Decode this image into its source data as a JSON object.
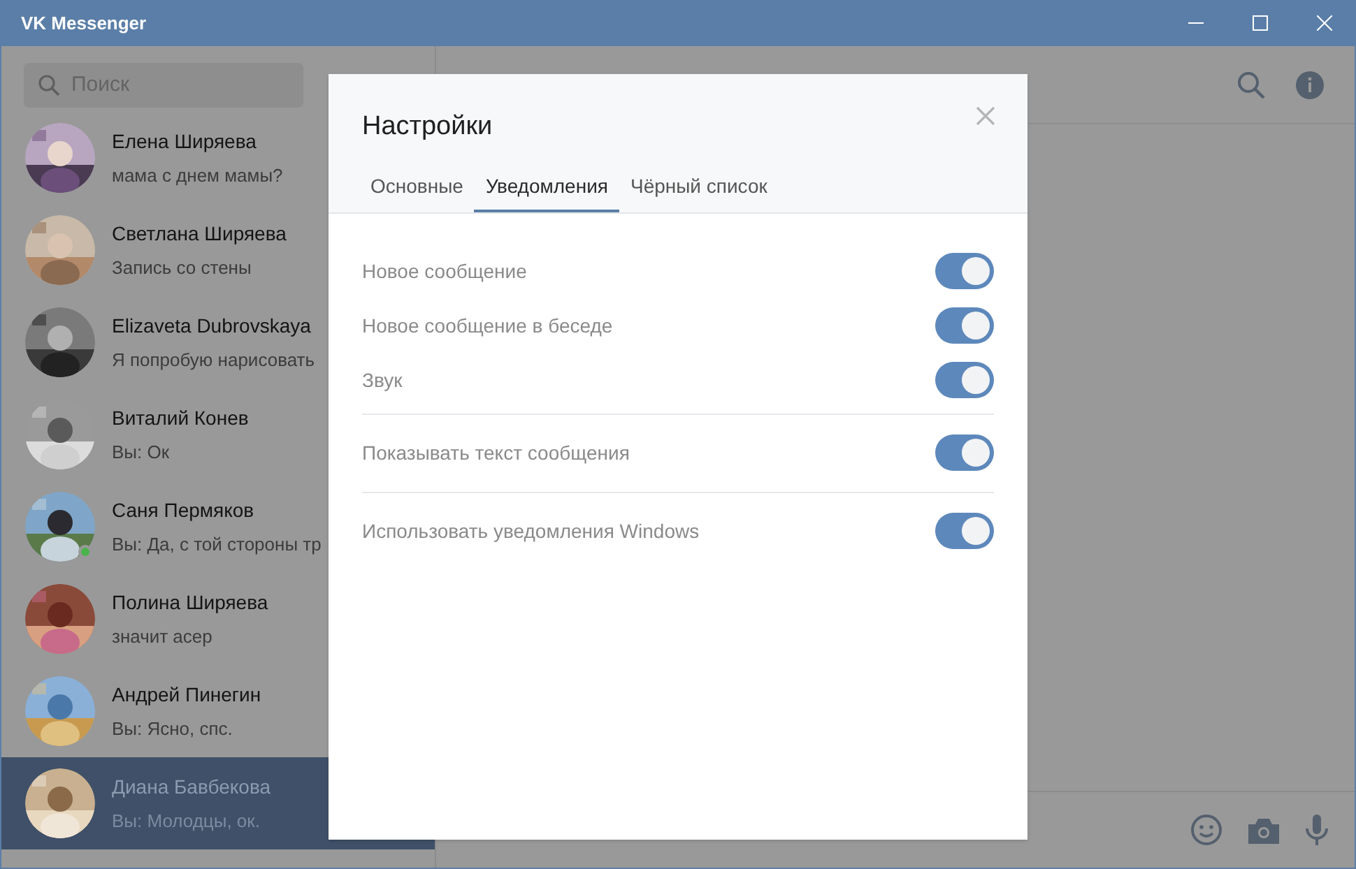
{
  "window": {
    "title": "VK Messenger"
  },
  "sidebar": {
    "search": {
      "placeholder": "Поиск"
    },
    "dialogs": [
      {
        "name": "Елена Ширяева",
        "preview": "мама с днем мамы?",
        "online": false,
        "selected": false
      },
      {
        "name": "Светлана Ширяева",
        "preview": "Запись со стены",
        "online": false,
        "selected": false
      },
      {
        "name": "Elizaveta Dubrovskaya",
        "preview": "Я попробую нарисовать",
        "online": false,
        "selected": false
      },
      {
        "name": "Виталий Конев",
        "preview": "Вы: Ок",
        "online": false,
        "selected": false
      },
      {
        "name": "Саня Пермяков",
        "preview": "Вы: Да, с той стороны тр",
        "online": true,
        "selected": false
      },
      {
        "name": "Полина Ширяева",
        "preview": "значит асер",
        "online": false,
        "selected": false
      },
      {
        "name": "Андрей Пинегин",
        "preview": "Вы: Ясно, спс.",
        "online": false,
        "selected": false
      },
      {
        "name": "Диана Бавбекова",
        "preview": "Вы: Молодцы, ок.",
        "online": false,
        "selected": true
      }
    ]
  },
  "settings_dialog": {
    "title": "Настройки",
    "tabs": [
      {
        "label": "Основные",
        "selected": false
      },
      {
        "label": "Уведомления",
        "selected": true
      },
      {
        "label": "Чёрный список",
        "selected": false
      }
    ],
    "groups": [
      [
        {
          "label": "Новое сообщение",
          "on": true
        },
        {
          "label": "Новое сообщение в беседе",
          "on": true
        },
        {
          "label": "Звук",
          "on": true
        }
      ],
      [
        {
          "label": "Показывать текст сообщения",
          "on": true
        }
      ],
      [
        {
          "label": "Использовать уведомления Windows",
          "on": true
        }
      ]
    ]
  }
}
